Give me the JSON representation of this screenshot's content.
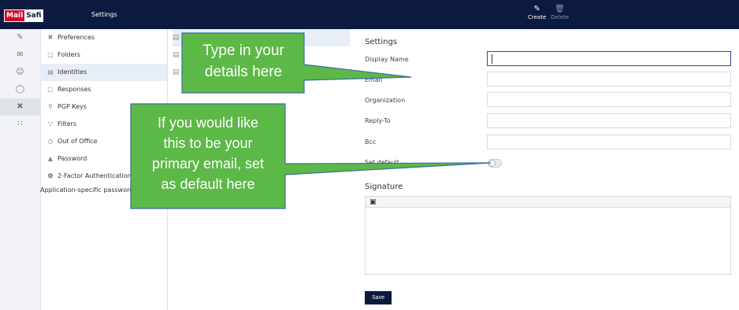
{
  "app": {
    "logo_part1": "Mail",
    "logo_part2": "Safi",
    "section_title": "Settings"
  },
  "toolbar": {
    "create_label": "Create",
    "delete_label": "Delete"
  },
  "rail": {
    "items": [
      "compose-icon",
      "mail-icon",
      "contacts-icon",
      "globe-icon",
      "settings-icon",
      "apps-icon"
    ]
  },
  "settings_menu": {
    "items": [
      {
        "label": "Preferences",
        "icon": "tools-icon"
      },
      {
        "label": "Folders",
        "icon": "folder-icon"
      },
      {
        "label": "Identities",
        "icon": "identity-card-icon",
        "selected": true
      },
      {
        "label": "Responses",
        "icon": "message-icon"
      },
      {
        "label": "PGP Keys",
        "icon": "key-icon"
      },
      {
        "label": "Filters",
        "icon": "filter-icon"
      },
      {
        "label": "Out of Office",
        "icon": "clock-icon"
      },
      {
        "label": "Password",
        "icon": "lock-icon"
      },
      {
        "label": "2-Factor Authentication",
        "icon": "gear-icon"
      },
      {
        "label": "Application-specific passwords"
      }
    ]
  },
  "form": {
    "heading": "Settings",
    "display_name_label": "Display Name",
    "email_label": "Email",
    "organization_label": "Organization",
    "reply_to_label": "Reply-To",
    "bcc_label": "Bcc",
    "set_default_label": "Set default",
    "set_default_on": false,
    "signature_heading": "Signature",
    "save_label": "Save"
  },
  "callouts": {
    "type_details": [
      "Type in your",
      "details here"
    ],
    "set_default": [
      "If you would like",
      "this to be your",
      "primary email, set",
      "as default here"
    ],
    "fill_color": "#5cb847",
    "border_color": "#3a6ea5"
  }
}
